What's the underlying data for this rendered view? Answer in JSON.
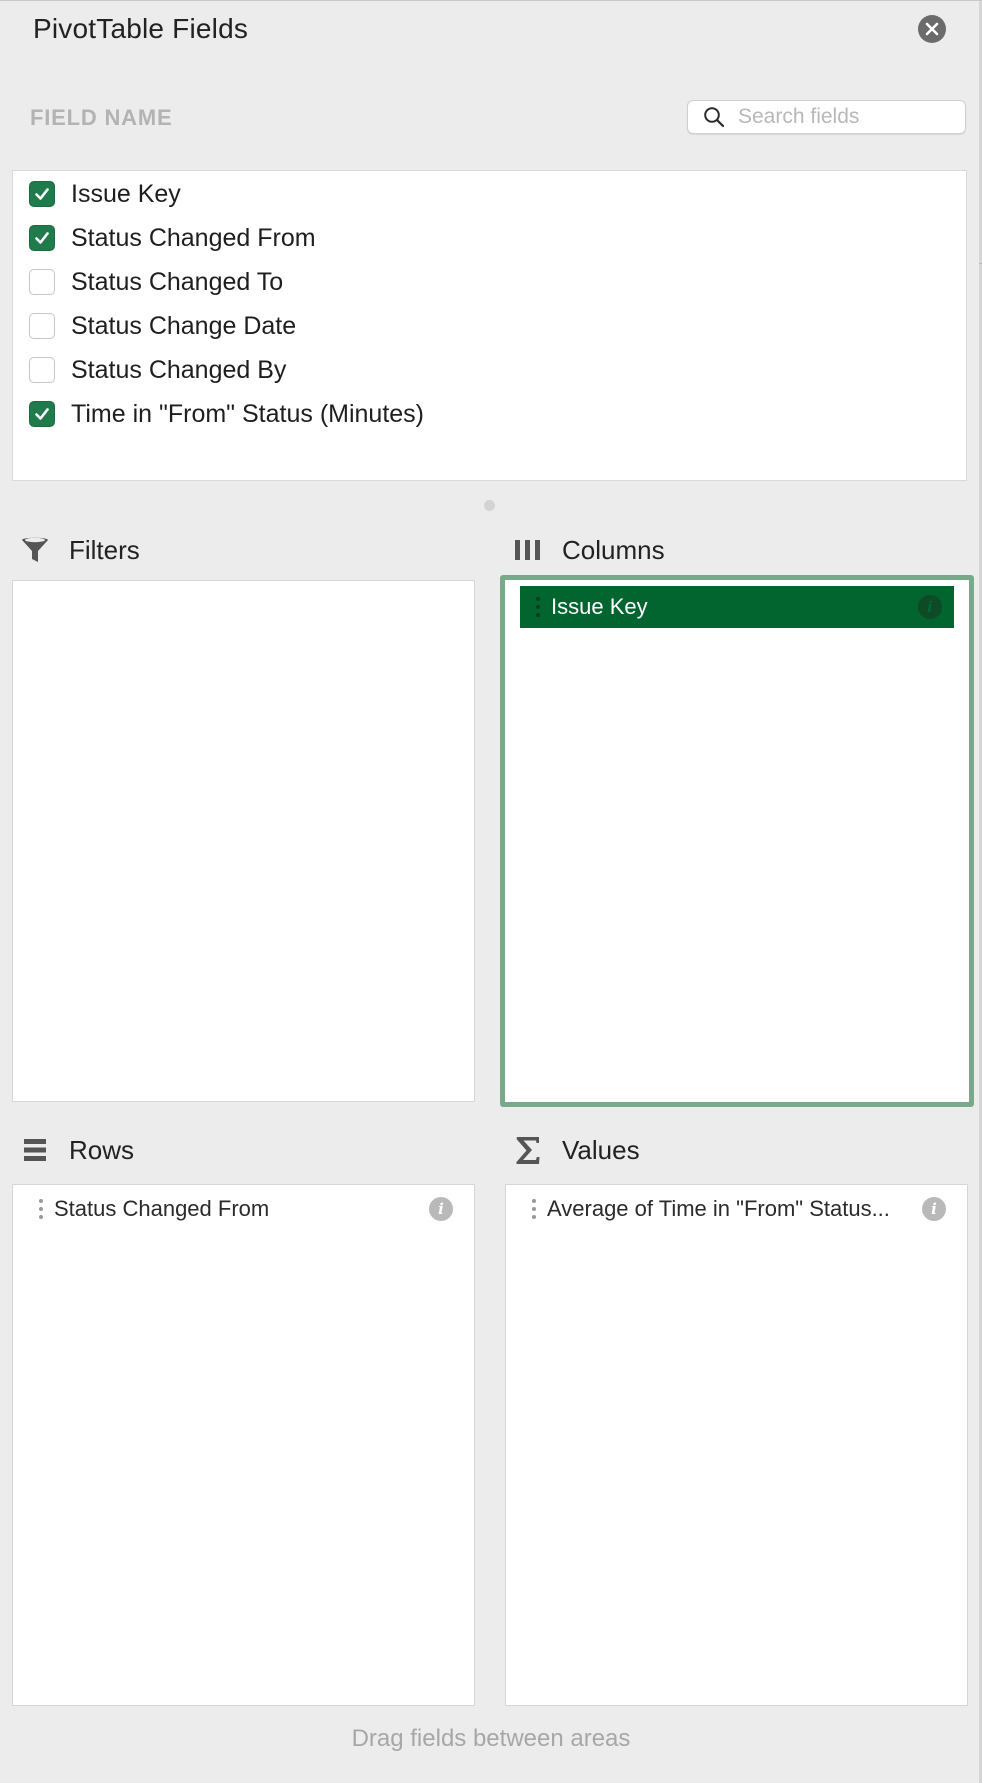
{
  "panel": {
    "title": "PivotTable Fields"
  },
  "fields_header": {
    "label": "FIELD NAME",
    "search_placeholder": "Search fields",
    "search_value": ""
  },
  "fields": [
    {
      "label": "Issue Key",
      "checked": true
    },
    {
      "label": "Status Changed From",
      "checked": true
    },
    {
      "label": "Status Changed To",
      "checked": false
    },
    {
      "label": "Status Change Date",
      "checked": false
    },
    {
      "label": "Status Changed By",
      "checked": false
    },
    {
      "label": "Time in \"From\" Status (Minutes)",
      "checked": true
    }
  ],
  "areas": {
    "filters": {
      "title": "Filters",
      "icon": "filter-funnel-icon",
      "items": []
    },
    "columns": {
      "title": "Columns",
      "icon": "columns-icon",
      "items": [
        {
          "label": "Issue Key",
          "selected": true
        }
      ]
    },
    "rows": {
      "title": "Rows",
      "icon": "rows-icon",
      "items": [
        {
          "label": "Status Changed From",
          "selected": false
        }
      ]
    },
    "values": {
      "title": "Values",
      "icon": "sigma-icon",
      "items": [
        {
          "label": "Average of Time in \"From\" Status...",
          "selected": false
        }
      ]
    }
  },
  "footer": {
    "hint": "Drag fields between areas"
  },
  "colors": {
    "accent_green": "#1f7a4c",
    "selected_chip": "#02652f",
    "drop_highlight": "#78a98a",
    "panel_background": "#ececec"
  }
}
